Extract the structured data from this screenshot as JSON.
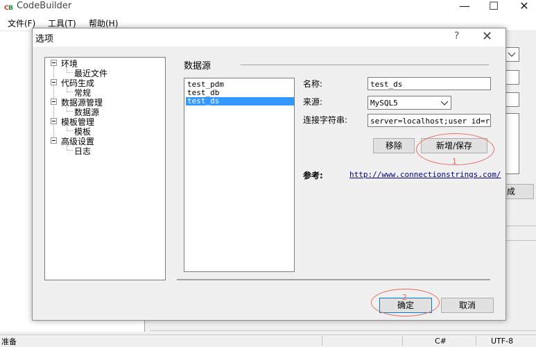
{
  "app": {
    "title": "CodeBuilder",
    "icon": "cb-app-icon"
  },
  "window_controls": {
    "minimize": "—",
    "maximize": "☐",
    "close": "✕"
  },
  "menubar": [
    {
      "label": "文件(F)"
    },
    {
      "label": "工具(T)"
    },
    {
      "label": "帮助(H)"
    }
  ],
  "background": {
    "generate_button_fragment": "成"
  },
  "status": {
    "left": "准备",
    "lang": "C#",
    "encoding": "UTF-8"
  },
  "dialog": {
    "title": "选项",
    "help": "?",
    "close": "✕",
    "tree": [
      {
        "label": "环境",
        "children": [
          {
            "label": "最近文件"
          }
        ]
      },
      {
        "label": "代码生成",
        "children": [
          {
            "label": "常规"
          }
        ]
      },
      {
        "label": "数据源管理",
        "children": [
          {
            "label": "数据源"
          }
        ]
      },
      {
        "label": "模板管理",
        "children": [
          {
            "label": "模板"
          }
        ]
      },
      {
        "label": "高级设置",
        "children": [
          {
            "label": "日志"
          }
        ]
      }
    ],
    "section_title": "数据源",
    "datasources": [
      "test_pdm",
      "test_db",
      "test_ds"
    ],
    "selected_datasource": "test_ds",
    "form": {
      "name_label": "名称:",
      "name_value": "test_ds",
      "source_label": "来源:",
      "source_value": "MySQL5",
      "conn_label": "连接字符串:",
      "conn_value": "server=localhost;user id=root",
      "remove_button": "移除",
      "save_button": "新增/保存",
      "ref_label": "参考:",
      "ref_url": "http://www.connectionstrings.com/"
    },
    "ok_button": "确定",
    "cancel_button": "取消"
  },
  "annotations": [
    "1",
    "2"
  ],
  "colors": {
    "selection": "#3399ff",
    "annotation": "#e86a5b",
    "link": "#000080"
  }
}
